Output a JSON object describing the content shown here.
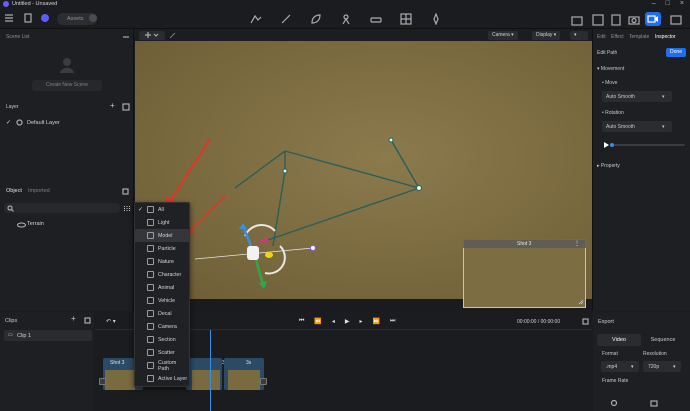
{
  "window": {
    "title": "Untitled - Unsaved"
  },
  "toolbar": {
    "assets_label": "Assets"
  },
  "left_panel": {
    "scene_list_title": "Scene List",
    "create_scene_label": "Create New Scene",
    "layer_title": "Layer",
    "layer_items": [
      "Default Layer"
    ],
    "tabs": [
      "Object",
      "Imported"
    ],
    "object_items": [
      "Terrain"
    ]
  },
  "viewport": {
    "camera_label": "Camera",
    "display_label": "Display",
    "shot_preview_title": "Shot 3"
  },
  "right_panel": {
    "tabs": [
      "Edit",
      "Effect",
      "Template",
      "Inspector"
    ],
    "edit_path_label": "Edit Path",
    "done_label": "Done",
    "movement_label": "Movement",
    "move_label": "Move",
    "move_value": "Auto Smooth",
    "rotation_label": "Rotation",
    "rotation_value": "Auto Smooth",
    "property_label": "Property"
  },
  "clips": {
    "title": "Clips",
    "items": [
      "Clip 1"
    ]
  },
  "timeline": {
    "current_time": "00:00:00",
    "total_time": "00:00:00",
    "segments": [
      "Shot 3",
      "3s",
      "3s"
    ]
  },
  "export": {
    "title": "Export",
    "tabs": [
      "Video",
      "Sequence"
    ],
    "format_label": "Format",
    "format_value": ".mp4",
    "resolution_label": "Resolution",
    "resolution_value": "720p",
    "frame_rate_label": "Frame Rate"
  },
  "menu": {
    "items": [
      "All",
      "Light",
      "Model",
      "Particle",
      "Nature",
      "Character",
      "Animal",
      "Vehicle",
      "Decal",
      "Camera",
      "Section",
      "Scatter",
      "Custom Path",
      "Active Layer"
    ],
    "checked_item": "All",
    "highlighted_item": "Model"
  },
  "colors": {
    "accent": "#1f6feb",
    "terrain": "#7a6a3f",
    "path_line": "#2e5e5a",
    "annotation_arrow": "#d63a2a"
  }
}
